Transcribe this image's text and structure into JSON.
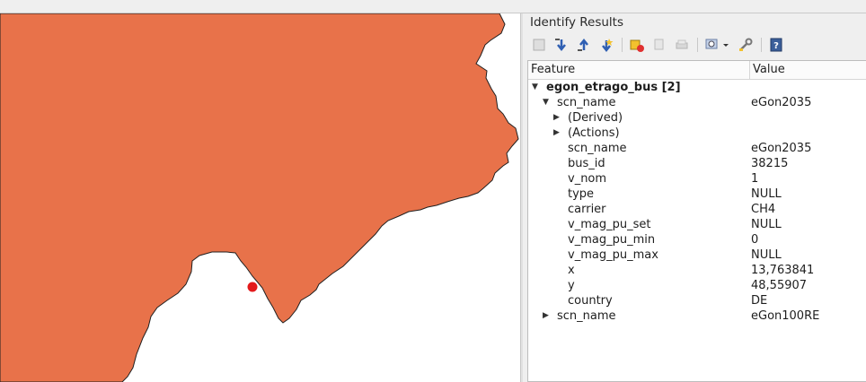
{
  "colors": {
    "land": "#e8724a",
    "land_border": "#202020",
    "point": "#e31a1c"
  },
  "panel": {
    "title": "Identify Results"
  },
  "toolbar": [
    {
      "name": "expand-tree-icon"
    },
    {
      "name": "expand-all-icon"
    },
    {
      "name": "collapse-all-icon"
    },
    {
      "name": "expand-new-results-icon"
    },
    {
      "name": "clear-results-icon"
    },
    {
      "name": "copy-feature-icon"
    },
    {
      "name": "print-icon"
    },
    {
      "name": "identify-mode-icon"
    },
    {
      "name": "settings-icon"
    },
    {
      "name": "help-icon"
    }
  ],
  "tree": {
    "headers": {
      "feature": "Feature",
      "value": "Value"
    },
    "rows": [
      {
        "depth": 0,
        "arrow": "down",
        "key": "egon_etrago_bus  [2]",
        "value": "",
        "bold": true
      },
      {
        "depth": 1,
        "arrow": "down",
        "key": "scn_name",
        "value": "eGon2035"
      },
      {
        "depth": 2,
        "arrow": "right",
        "key": "(Derived)",
        "value": ""
      },
      {
        "depth": 2,
        "arrow": "right",
        "key": "(Actions)",
        "value": ""
      },
      {
        "depth": 2,
        "arrow": "",
        "key": "scn_name",
        "value": "eGon2035"
      },
      {
        "depth": 2,
        "arrow": "",
        "key": "bus_id",
        "value": "38215"
      },
      {
        "depth": 2,
        "arrow": "",
        "key": "v_nom",
        "value": "1"
      },
      {
        "depth": 2,
        "arrow": "",
        "key": "type",
        "value": "NULL"
      },
      {
        "depth": 2,
        "arrow": "",
        "key": "carrier",
        "value": "CH4"
      },
      {
        "depth": 2,
        "arrow": "",
        "key": "v_mag_pu_set",
        "value": "NULL"
      },
      {
        "depth": 2,
        "arrow": "",
        "key": "v_mag_pu_min",
        "value": "0"
      },
      {
        "depth": 2,
        "arrow": "",
        "key": "v_mag_pu_max",
        "value": "NULL"
      },
      {
        "depth": 2,
        "arrow": "",
        "key": "x",
        "value": "13,763841"
      },
      {
        "depth": 2,
        "arrow": "",
        "key": "y",
        "value": "48,55907"
      },
      {
        "depth": 2,
        "arrow": "",
        "key": "country",
        "value": "DE"
      },
      {
        "depth": 1,
        "arrow": "right",
        "key": "scn_name",
        "value": "eGon100RE"
      }
    ]
  }
}
